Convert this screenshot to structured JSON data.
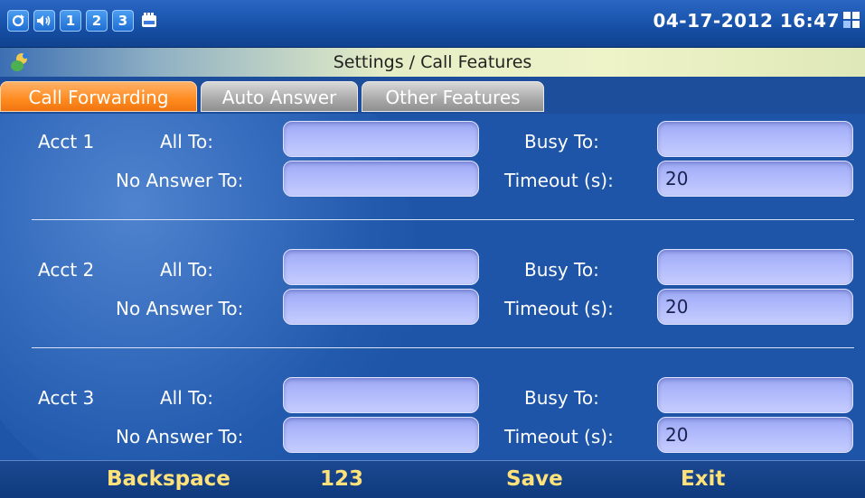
{
  "status_bar": {
    "icons": [
      {
        "name": "sync-icon",
        "glyph": "↻"
      },
      {
        "name": "volume-icon",
        "glyph": "◀"
      },
      {
        "name": "account-1-icon",
        "glyph": "1"
      },
      {
        "name": "account-2-icon",
        "glyph": "2"
      },
      {
        "name": "account-3-icon",
        "glyph": "3"
      },
      {
        "name": "memory-card-icon",
        "glyph": ""
      }
    ],
    "datetime": "04-17-2012 16:47"
  },
  "title_bar": {
    "title": "Settings / Call Features"
  },
  "tabs": [
    {
      "label": "Call Forwarding",
      "active": true
    },
    {
      "label": "Auto Answer",
      "active": false
    },
    {
      "label": "Other Features",
      "active": false
    }
  ],
  "accounts": [
    {
      "label": "Acct 1",
      "all_to_label": "All To:",
      "all_to_value": "",
      "busy_to_label": "Busy To:",
      "busy_to_value": "",
      "no_answer_to_label": "No Answer To:",
      "no_answer_to_value": "",
      "timeout_label": "Timeout (s):",
      "timeout_value": "20"
    },
    {
      "label": "Acct 2",
      "all_to_label": "All To:",
      "all_to_value": "",
      "busy_to_label": "Busy To:",
      "busy_to_value": "",
      "no_answer_to_label": "No Answer To:",
      "no_answer_to_value": "",
      "timeout_label": "Timeout (s):",
      "timeout_value": "20"
    },
    {
      "label": "Acct 3",
      "all_to_label": "All To:",
      "all_to_value": "",
      "busy_to_label": "Busy To:",
      "busy_to_value": "",
      "no_answer_to_label": "No Answer To:",
      "no_answer_to_value": "",
      "timeout_label": "Timeout (s):",
      "timeout_value": "20"
    }
  ],
  "softkeys": {
    "backspace": "Backspace",
    "mode": "123",
    "save": "Save",
    "exit": "Exit"
  },
  "colors": {
    "active_tab": "#ff8b1f",
    "softkey_text": "#ffe27a",
    "background": "#1e55a8",
    "field": "#aeb8fb"
  }
}
